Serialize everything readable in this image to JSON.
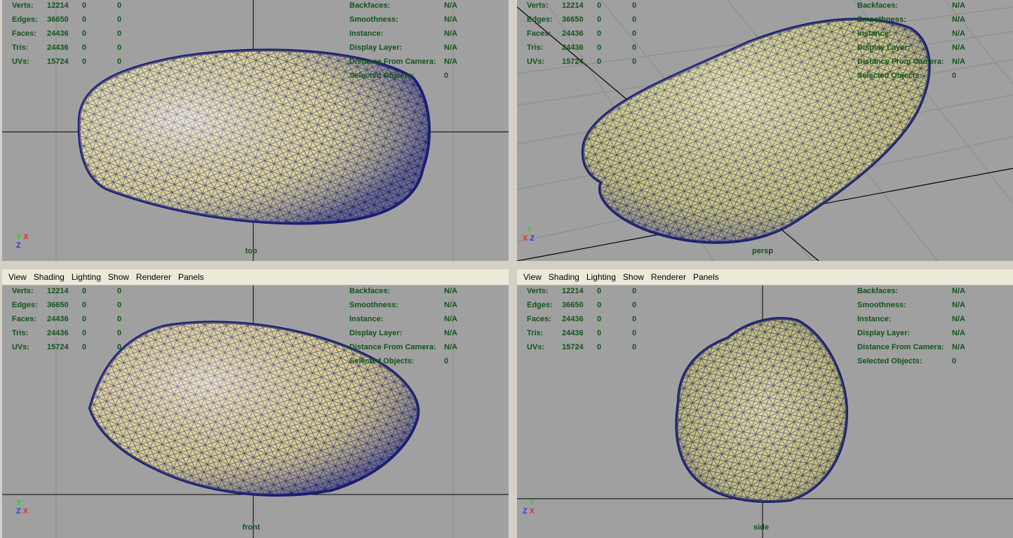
{
  "colors": {
    "viewport_bg": "#a0a0a0",
    "hud_text": "#12531c",
    "wire": "#1a1e74",
    "mesh_fill": "#dad29a",
    "axis_x": "#e03030",
    "axis_y": "#1ed31e",
    "axis_z": "#2a3cf0"
  },
  "menu": [
    "View",
    "Shading",
    "Lighting",
    "Show",
    "Renderer",
    "Panels"
  ],
  "hud": {
    "stats": [
      {
        "label": "Verts:",
        "value": "12214",
        "c2": "0",
        "c3": "0"
      },
      {
        "label": "Edges:",
        "value": "36650",
        "c2": "0",
        "c3": "0"
      },
      {
        "label": "Faces:",
        "value": "24436",
        "c2": "0",
        "c3": "0"
      },
      {
        "label": "Tris:",
        "value": "24436",
        "c2": "0",
        "c3": "0"
      },
      {
        "label": "UVs:",
        "value": "15724",
        "c2": "0",
        "c3": "0"
      }
    ],
    "right": [
      {
        "label": "Backfaces:",
        "value": "N/A"
      },
      {
        "label": "Smoothness:",
        "value": "N/A"
      },
      {
        "label": "Instance:",
        "value": "N/A"
      },
      {
        "label": "Display Layer:",
        "value": "N/A"
      },
      {
        "label": "Distance From Camera:",
        "value": "N/A"
      },
      {
        "label": "Selected Objects:",
        "value": "0"
      }
    ]
  },
  "viewports": [
    {
      "camera": "top",
      "axes": [
        "Y",
        "X",
        "Z"
      ]
    },
    {
      "camera": "persp",
      "axes": [
        "Y",
        "X",
        "Z"
      ]
    },
    {
      "camera": "front",
      "axes": [
        "Y",
        "Z",
        "X"
      ]
    },
    {
      "camera": "side",
      "axes": [
        "Y",
        "Z",
        "X"
      ]
    }
  ]
}
